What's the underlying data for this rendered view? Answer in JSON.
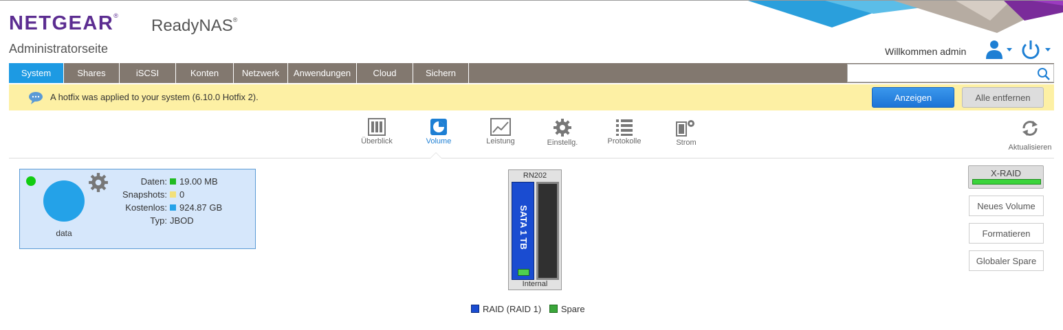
{
  "header": {
    "brand": "NETGEAR",
    "product": "ReadyNAS",
    "subtitle": "Administratorseite",
    "welcome": "Willkommen admin",
    "colors": {
      "brand": "#5c2d91",
      "accent": "#1d9ae3"
    }
  },
  "tabs": [
    {
      "label": "System",
      "active": true
    },
    {
      "label": "Shares"
    },
    {
      "label": "iSCSI"
    },
    {
      "label": "Konten"
    },
    {
      "label": "Netzwerk"
    },
    {
      "label": "Anwendungen"
    },
    {
      "label": "Cloud"
    },
    {
      "label": "Sichern"
    }
  ],
  "search": {
    "value": "",
    "placeholder": ""
  },
  "notice": {
    "text": "A hotfix was applied to your system (6.10.0 Hotfix 2).",
    "show_label": "Anzeigen",
    "remove_label": "Alle entfernen"
  },
  "subnav": [
    {
      "label": "Überblick",
      "icon": "overview-icon"
    },
    {
      "label": "Volume",
      "icon": "volume-icon",
      "active": true
    },
    {
      "label": "Leistung",
      "icon": "performance-icon"
    },
    {
      "label": "Einstellg.",
      "icon": "gear-icon"
    },
    {
      "label": "Protokolle",
      "icon": "logs-icon"
    },
    {
      "label": "Strom",
      "icon": "power-settings-icon"
    }
  ],
  "refresh_label": "Aktualisieren",
  "volume": {
    "name": "data",
    "status_color": "#11cc11",
    "stats": [
      {
        "label": "Daten:",
        "value": "19.00 MB",
        "color": "#22bb22"
      },
      {
        "label": "Snapshots:",
        "value": "0",
        "color": "#f2e07a"
      },
      {
        "label": "Kostenlos:",
        "value": "924.87 GB",
        "color": "#24a2e8"
      },
      {
        "label": "Typ:",
        "value": "JBOD"
      }
    ]
  },
  "chassis": {
    "model": "RN202",
    "disk_label": "SATA 1 TB",
    "bay_label": "Internal"
  },
  "legend": [
    {
      "label": "RAID (RAID 1)",
      "color": "#1a4cd1"
    },
    {
      "label": "Spare",
      "color": "#3aa63a"
    }
  ],
  "sidebar_buttons": {
    "xraid": "X-RAID",
    "new_volume": "Neues Volume",
    "format": "Formatieren",
    "global_spare": "Globaler Spare"
  }
}
